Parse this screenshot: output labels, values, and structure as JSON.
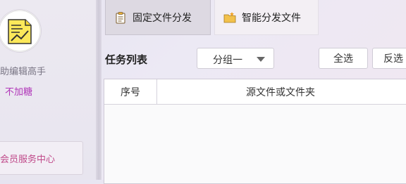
{
  "sidebar": {
    "app_name": "助编辑高手",
    "user_status": "不加糖",
    "member_center": "会员服务中心",
    "logo_icon": "chart-note-logo-icon"
  },
  "tabs": [
    {
      "label": "固定文件分发",
      "icon": "clipboard-icon",
      "active": true
    },
    {
      "label": "智能分发文件",
      "icon": "folder-star-icon",
      "active": false
    }
  ],
  "toolbar": {
    "task_list_label": "任务列表",
    "group_select_value": "分组一",
    "select_all_label": "全选",
    "invert_label": "反选"
  },
  "table": {
    "columns": [
      "序号",
      "源文件或文件夹"
    ],
    "rows": []
  },
  "colors": {
    "accent_purple": "#b035b8",
    "member_pink": "#c04a8a"
  }
}
